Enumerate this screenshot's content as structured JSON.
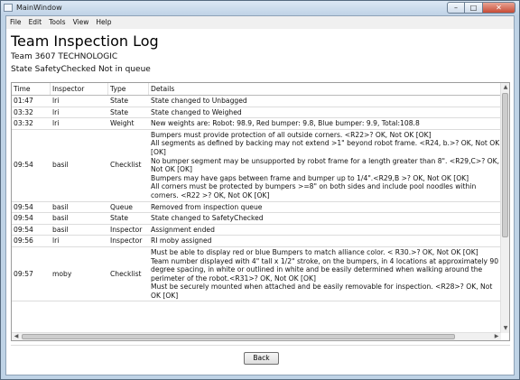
{
  "window": {
    "title": "MainWindow",
    "controls": {
      "minimize": "–",
      "maximize": "□",
      "close": "✕"
    }
  },
  "menu": [
    "File",
    "Edit",
    "Tools",
    "View",
    "Help"
  ],
  "header": {
    "title": "Team Inspection Log",
    "team": "Team 3607 TECHNOLOGIC",
    "state": "State  SafetyChecked Not in queue"
  },
  "table": {
    "columns": [
      "Time",
      "Inspector",
      "Type",
      "Details"
    ],
    "rows": [
      {
        "time": "01:47",
        "inspector": "lri",
        "type": "State",
        "details": [
          "State changed to Unbagged"
        ]
      },
      {
        "time": "03:32",
        "inspector": "lri",
        "type": "State",
        "details": [
          "State changed to Weighed"
        ]
      },
      {
        "time": "03:32",
        "inspector": "lri",
        "type": "Weight",
        "details": [
          "New weights are: Robot: 98.9, Red bumper: 9.8, Blue bumper: 9.9, Total:108.8"
        ]
      },
      {
        "time": "09:54",
        "inspector": "basil",
        "type": "Checklist",
        "details": [
          "Bumpers must provide protection of all outside corners. <R22>? OK, Not OK  [OK]",
          "All segments as defined by backing may not extend >1\" beyond robot frame. <R24, b.>? OK, Not OK",
          "[OK]",
          "No bumper segment may be unsupported by robot frame for a length greater than 8\". <R29,C>? OK,",
          "Not OK  [OK]",
          "Bumpers may have gaps between frame and bumper up to 1/4\".<R29,B >? OK, Not OK  [OK]",
          "All corners must be protected by bumpers >=8\" on both sides and include pool noodles within",
          "corners. <R22 >? OK, Not OK  [OK]"
        ]
      },
      {
        "time": "09:54",
        "inspector": "basil",
        "type": "Queue",
        "details": [
          "Removed from inspection queue"
        ]
      },
      {
        "time": "09:54",
        "inspector": "basil",
        "type": "State",
        "details": [
          "State changed to SafetyChecked"
        ]
      },
      {
        "time": "09:54",
        "inspector": "basil",
        "type": "Inspector",
        "details": [
          "Assignment ended"
        ]
      },
      {
        "time": "09:56",
        "inspector": "lri",
        "type": "Inspector",
        "details": [
          "RI moby assigned"
        ]
      },
      {
        "time": "09:57",
        "inspector": "moby",
        "type": "Checklist",
        "details": [
          "Must be able to display red or blue Bumpers to match alliance color. < R30.>? OK, Not OK  [OK]",
          "Team number displayed with 4\" tall x 1/2\" stroke, on the bumpers, in 4 locations at approximately 90",
          "degree spacing, in white or outlined in white and be easily determined when walking around the",
          "perimeter of the robot.<R31>? OK, Not OK  [OK]",
          "Must be securely mounted when attached and be easily removable for inspection. <R28>? OK, Not",
          "OK  [OK]"
        ]
      }
    ]
  },
  "back_label": "Back",
  "scroll_glyphs": {
    "up": "▲",
    "down": "▼",
    "left": "◀",
    "right": "▶"
  }
}
